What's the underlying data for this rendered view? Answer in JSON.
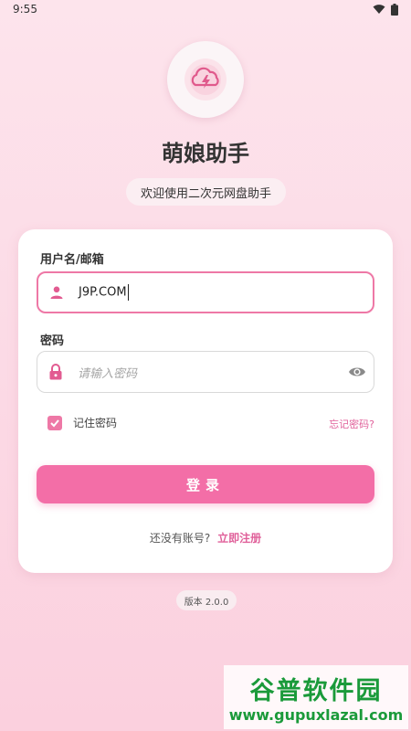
{
  "status_bar": {
    "time": "9:55"
  },
  "app": {
    "title": "萌娘助手",
    "subtitle": "欢迎使用二次元网盘助手"
  },
  "form": {
    "username_label": "用户名/邮箱",
    "username_value": "J9P.COM",
    "password_label": "密码",
    "password_placeholder": "请输入密码",
    "remember_label": "记住密码",
    "remember_checked": true,
    "forgot_label": "忘记密码?",
    "login_label": "登录",
    "register_prompt": "还没有账号?",
    "register_link": "立即注册"
  },
  "footer": {
    "version": "版本 2.0.0"
  },
  "watermark": {
    "top": "谷普软件园",
    "bottom": "www.gupuxlazal.com"
  },
  "colors": {
    "accent": "#f36ea7",
    "link": "#e0609a",
    "watermark": "#1a9a3a"
  },
  "icons": [
    "wifi-icon",
    "battery-icon",
    "cloud-lightning-logo-icon",
    "user-icon",
    "lock-icon",
    "eye-icon",
    "check-icon"
  ]
}
